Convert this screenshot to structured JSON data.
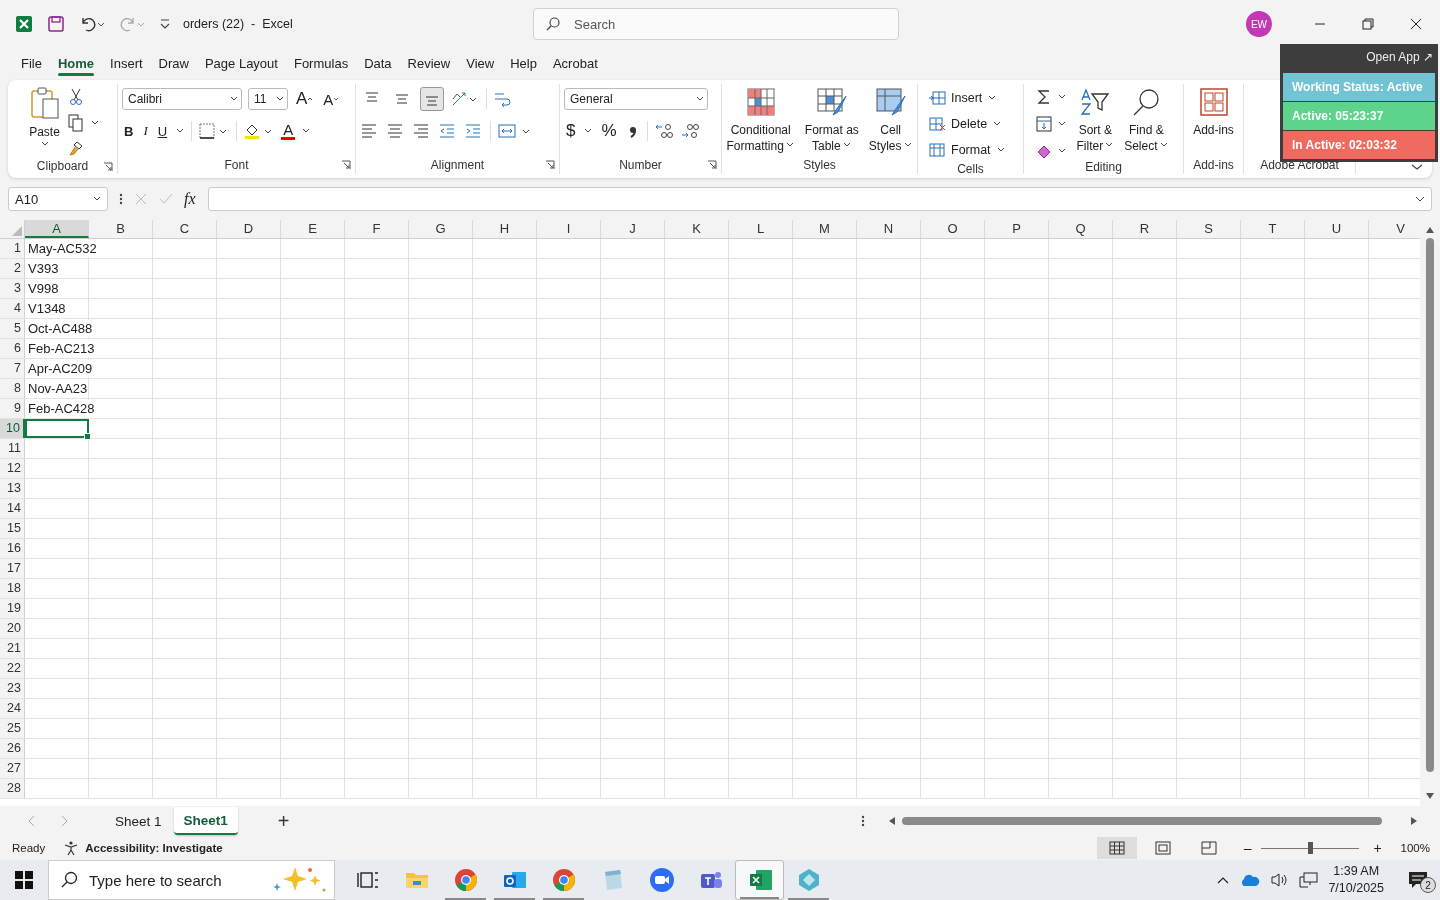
{
  "window": {
    "title": "orders (22)  -  Excel",
    "search_placeholder": "Search",
    "avatar": "EW"
  },
  "menu": [
    {
      "label": "File",
      "selected": false
    },
    {
      "label": "Home",
      "selected": true
    },
    {
      "label": "Insert",
      "selected": false
    },
    {
      "label": "Draw",
      "selected": false
    },
    {
      "label": "Page Layout",
      "selected": false
    },
    {
      "label": "Formulas",
      "selected": false
    },
    {
      "label": "Data",
      "selected": false
    },
    {
      "label": "Review",
      "selected": false
    },
    {
      "label": "View",
      "selected": false
    },
    {
      "label": "Help",
      "selected": false
    },
    {
      "label": "Acrobat",
      "selected": false
    }
  ],
  "ribbon": {
    "clipboard": {
      "label": "Clipboard",
      "paste": "Paste"
    },
    "font": {
      "label": "Font",
      "name": "Calibri",
      "size": "11",
      "grow": "A",
      "shrink": "A",
      "bold": "B",
      "italic": "I",
      "underline": "U",
      "font_color": "A"
    },
    "alignment": {
      "label": "Alignment",
      "vertical": [
        {
          "selected": false
        },
        {
          "selected": false
        },
        {
          "selected": true
        }
      ]
    },
    "number": {
      "label": "Number",
      "format": "General",
      "currency": "$",
      "percent": "%"
    },
    "styles": {
      "label": "Styles",
      "buttons": [
        {
          "kind": "conditional",
          "lines": [
            "Conditional",
            "Formatting"
          ]
        },
        {
          "kind": "table",
          "lines": [
            "Format as",
            "Table"
          ]
        },
        {
          "kind": "cellstyles",
          "lines": [
            "Cell",
            "Styles"
          ]
        }
      ]
    },
    "cells": {
      "label": "Cells",
      "buttons": [
        {
          "kind": "insert",
          "label": "Insert"
        },
        {
          "kind": "delete",
          "label": "Delete"
        },
        {
          "kind": "format",
          "label": "Format"
        }
      ]
    },
    "editing": {
      "label": "Editing",
      "buttons": [
        {
          "kind": "sort",
          "lines": [
            "Sort &",
            "Filter"
          ]
        },
        {
          "kind": "find",
          "lines": [
            "Find &",
            "Select"
          ]
        }
      ]
    },
    "addins": {
      "label": "Add-ins",
      "button": "Add-ins"
    },
    "acrobat": {
      "label": "Adobe Acrobat"
    }
  },
  "overlay": {
    "open_app": "Open App ↗",
    "statuses": [
      {
        "text": "Working Status: Active",
        "color": "#72c3d3"
      },
      {
        "text": "Active: 05:23:37",
        "color": "#5dd38b"
      },
      {
        "text": "In Active: 02:03:32",
        "color": "#ef6b60"
      }
    ]
  },
  "formula_bar": {
    "name_box": "A10",
    "fx": "fx"
  },
  "grid": {
    "columns": [
      {
        "label": "A",
        "selected": true
      },
      {
        "label": "B",
        "selected": false
      },
      {
        "label": "C",
        "selected": false
      },
      {
        "label": "D",
        "selected": false
      },
      {
        "label": "E",
        "selected": false
      },
      {
        "label": "F",
        "selected": false
      },
      {
        "label": "G",
        "selected": false
      },
      {
        "label": "H",
        "selected": false
      },
      {
        "label": "I",
        "selected": false
      },
      {
        "label": "J",
        "selected": false
      },
      {
        "label": "K",
        "selected": false
      },
      {
        "label": "L",
        "selected": false
      },
      {
        "label": "M",
        "selected": false
      },
      {
        "label": "N",
        "selected": false
      },
      {
        "label": "O",
        "selected": false
      },
      {
        "label": "P",
        "selected": false
      },
      {
        "label": "Q",
        "selected": false
      },
      {
        "label": "R",
        "selected": false
      },
      {
        "label": "S",
        "selected": false
      },
      {
        "label": "T",
        "selected": false
      },
      {
        "label": "U",
        "selected": false
      },
      {
        "label": "V",
        "selected": false
      }
    ],
    "rows": [
      {
        "label": "1",
        "value": "May-AC532",
        "selected": false
      },
      {
        "label": "2",
        "value": "V393",
        "selected": false
      },
      {
        "label": "3",
        "value": "V998",
        "selected": false
      },
      {
        "label": "4",
        "value": "V1348",
        "selected": false
      },
      {
        "label": "5",
        "value": "Oct-AC488",
        "selected": false
      },
      {
        "label": "6",
        "value": "Feb-AC213",
        "selected": false
      },
      {
        "label": "7",
        "value": "Apr-AC209",
        "selected": false
      },
      {
        "label": "8",
        "value": "Nov-AA23",
        "selected": false
      },
      {
        "label": "9",
        "value": "Feb-AC428",
        "selected": false
      },
      {
        "label": "10",
        "selected": true
      },
      {
        "label": "11",
        "selected": false
      },
      {
        "label": "12",
        "selected": false
      },
      {
        "label": "13",
        "selected": false
      },
      {
        "label": "14",
        "selected": false
      },
      {
        "label": "15",
        "selected": false
      },
      {
        "label": "16",
        "selected": false
      },
      {
        "label": "17",
        "selected": false
      },
      {
        "label": "18",
        "selected": false
      },
      {
        "label": "19",
        "selected": false
      },
      {
        "label": "20",
        "selected": false
      },
      {
        "label": "21",
        "selected": false
      },
      {
        "label": "22",
        "selected": false
      },
      {
        "label": "23",
        "selected": false
      },
      {
        "label": "24",
        "selected": false
      },
      {
        "label": "25",
        "selected": false
      },
      {
        "label": "26",
        "selected": false
      },
      {
        "label": "27",
        "selected": false
      },
      {
        "label": "28",
        "selected": false
      }
    ]
  },
  "sheet_tabs": [
    {
      "label": "Sheet 1",
      "selected": false
    },
    {
      "label": "Sheet1",
      "selected": true
    }
  ],
  "add_sheet": "+",
  "status": {
    "ready": "Ready",
    "accessibility": "Accessibility: Investigate",
    "views": [
      {
        "kind": "normal",
        "selected": true
      },
      {
        "kind": "page_layout",
        "selected": false
      },
      {
        "kind": "page_break",
        "selected": false
      }
    ],
    "zoom": {
      "minus": "–",
      "plus": "+",
      "level": 0.5,
      "reading": "100%"
    }
  },
  "taskbar": {
    "search_placeholder": "Type here to search",
    "apps": [
      {
        "kind": "taskview",
        "running": false,
        "selected": false
      },
      {
        "kind": "folder",
        "running": false,
        "selected": false
      },
      {
        "kind": "browser",
        "running": true,
        "selected": false
      },
      {
        "kind": "mail",
        "running": true,
        "selected": false
      },
      {
        "kind": "browser",
        "running": true,
        "selected": false
      },
      {
        "kind": "notepad",
        "running": false,
        "selected": false
      },
      {
        "kind": "video",
        "running": false,
        "selected": false
      },
      {
        "kind": "team",
        "running": false,
        "selected": false
      },
      {
        "kind": "spreadsheet",
        "running": true,
        "selected": true
      },
      {
        "kind": "diamond",
        "running": true,
        "selected": false
      }
    ],
    "time": "1:39 AM",
    "date": "7/10/2025",
    "notifications": "2"
  }
}
